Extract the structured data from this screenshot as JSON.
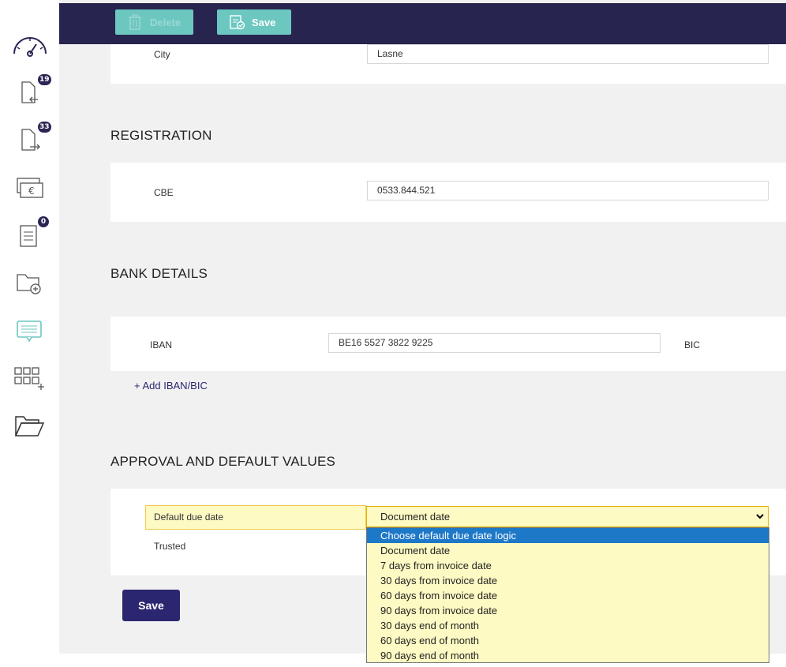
{
  "toolbar": {
    "delete_label": "Delete",
    "save_label": "Save"
  },
  "sidebar": {
    "badges": {
      "incoming": "19",
      "outgoing": "33",
      "tasks": "0"
    }
  },
  "address": {
    "city_label": "City",
    "city_value": "Lasne"
  },
  "registration": {
    "title": "REGISTRATION",
    "cbe_label": "CBE",
    "cbe_value": "0533.844.521"
  },
  "bank": {
    "title": "BANK DETAILS",
    "iban_label": "IBAN",
    "iban_value": "BE16 5527 3822 9225",
    "bic_label": "BIC",
    "add_link": "+ Add IBAN/BIC"
  },
  "approval": {
    "title": "APPROVAL AND DEFAULT VALUES",
    "due_date_label": "Default due date",
    "trusted_label": "Trusted",
    "due_date_selected": "Document date",
    "options": [
      "Choose default due date logic",
      "Document date",
      "7 days from invoice date",
      "30 days from invoice date",
      "60 days from invoice date",
      "90 days from invoice date",
      "30 days end of month",
      "60 days end of month",
      "90 days end of month"
    ]
  },
  "footer": {
    "save_label": "Save"
  },
  "colors": {
    "topbar": "#27244f",
    "accent_teal": "#6cc7c0",
    "primary_button": "#2b2670",
    "highlight": "#fdfac3",
    "option_selected": "#1e78c8"
  }
}
